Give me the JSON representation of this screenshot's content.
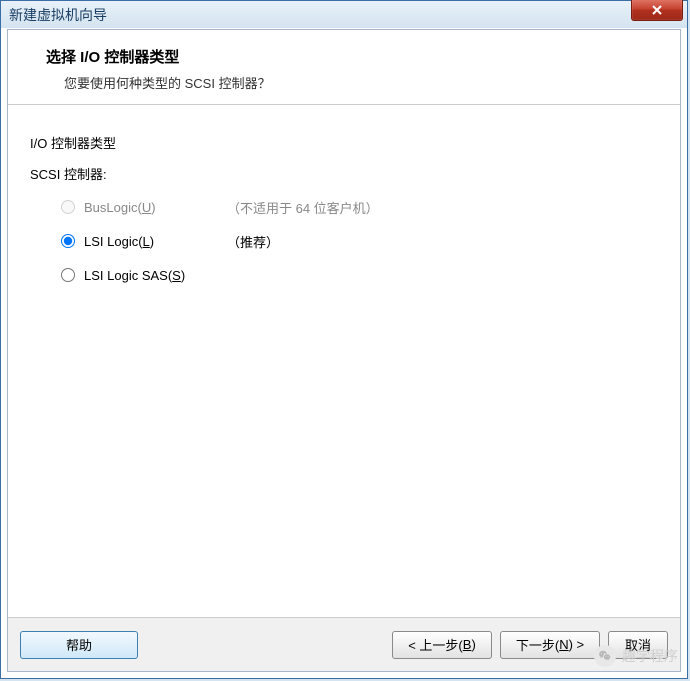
{
  "window": {
    "title": "新建虚拟机向导"
  },
  "header": {
    "title": "选择 I/O 控制器类型",
    "subtitle": "您要使用何种类型的 SCSI 控制器？"
  },
  "content": {
    "group_label": "I/O 控制器类型",
    "scsi_label": "SCSI 控制器:",
    "options": [
      {
        "label_pre": "BusLogic(",
        "label_key": "U",
        "label_post": ")",
        "note": "（不适用于 64 位客户机）",
        "disabled": true,
        "selected": false
      },
      {
        "label_pre": "LSI Logic(",
        "label_key": "L",
        "label_post": ")",
        "note": "（推荐）",
        "disabled": false,
        "selected": true
      },
      {
        "label_pre": "LSI Logic SAS(",
        "label_key": "S",
        "label_post": ")",
        "note": "",
        "disabled": false,
        "selected": false
      }
    ]
  },
  "footer": {
    "help": "帮助",
    "back_pre": "< 上一步(",
    "back_key": "B",
    "back_post": ")",
    "next_pre": "下一步(",
    "next_key": "N",
    "next_post": ") >",
    "cancel": "取消"
  },
  "watermark": {
    "text": "趣学程序"
  }
}
